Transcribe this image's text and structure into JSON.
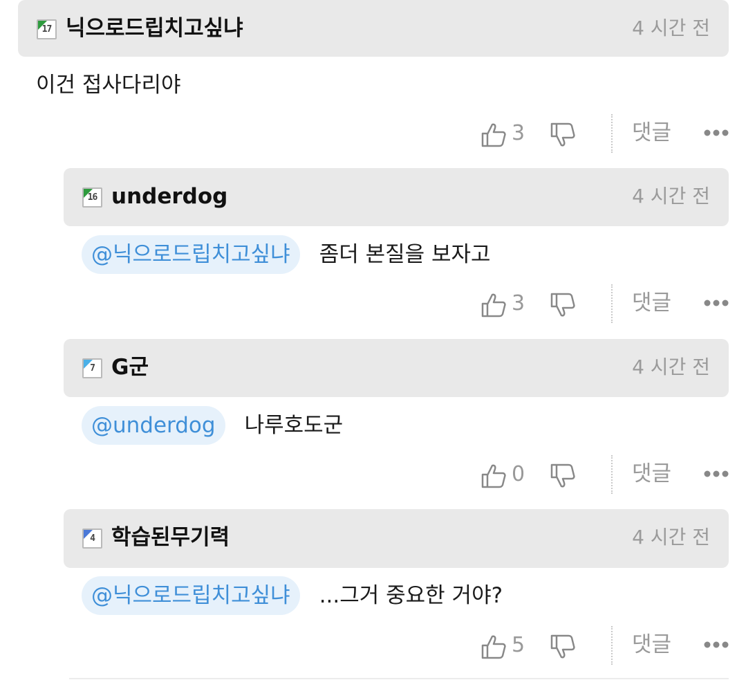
{
  "comments": [
    {
      "author": "닉으로드립치고싶냐",
      "level": "17",
      "level_color": "#2e9b3e",
      "time": "4 시간 전",
      "mention": "",
      "text": "이건 접사다리야",
      "likes": "3",
      "reply_label": "댓글"
    },
    {
      "author": "underdog",
      "level": "16",
      "level_color": "#2e9b3e",
      "time": "4 시간 전",
      "mention": "@닉으로드립치고싶냐",
      "text": "좀더 본질을 보자고",
      "likes": "3",
      "reply_label": "댓글"
    },
    {
      "author": "G군",
      "level": "7",
      "level_color": "#4ab0e8",
      "time": "4 시간 전",
      "mention": "@underdog",
      "text": "나루호도군",
      "likes": "0",
      "reply_label": "댓글"
    },
    {
      "author": "학습된무기력",
      "level": "4",
      "level_color": "#4a78d8",
      "time": "4 시간 전",
      "mention": "@닉으로드립치고싶냐",
      "text": "...그거 중요한 거야?",
      "likes": "5",
      "reply_label": "댓글"
    }
  ],
  "icons": {
    "like": "thumbs-up-icon",
    "dislike": "thumbs-down-icon",
    "more": "more-dots-icon"
  }
}
